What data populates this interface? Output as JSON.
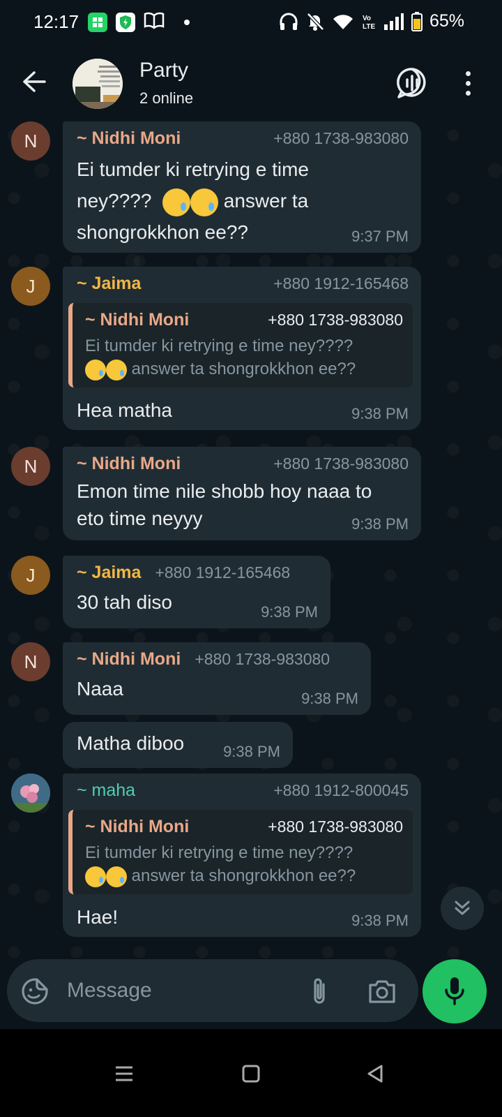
{
  "status_bar": {
    "time": "12:17",
    "battery_percent": "65%",
    "icons": [
      "app-icon",
      "shield-icon",
      "book-icon",
      "headphones-icon",
      "mute-icon",
      "wifi-icon",
      "volte-icon",
      "signal-icon",
      "battery-icon"
    ]
  },
  "header": {
    "title": "Party",
    "subtitle": "2 online"
  },
  "messages": [
    {
      "sender": "~ Nidhi Moni",
      "phone": "+880 1738-983080",
      "text_line1": "Ei tumder ki retrying e time",
      "text_line2_a": "ney????",
      "text_line2_b": "answer ta",
      "text_line3": "shongrokkhon ee??",
      "time": "9:37 PM",
      "avatar": "N"
    },
    {
      "sender": "~ Jaima",
      "phone": "+880 1912-165468",
      "quote_sender": "~ Nidhi Moni",
      "quote_phone": "+880 1738-983080",
      "quote_line1": "Ei tumder ki retrying e time ney????",
      "quote_line2": "answer ta shongrokkhon ee??",
      "text": "Hea matha",
      "time": "9:38 PM",
      "avatar": "J"
    },
    {
      "sender": "~ Nidhi Moni",
      "phone": "+880 1738-983080",
      "text_line1": "Emon time nile shobb hoy naaa to",
      "text_line2": "eto time neyyy",
      "time": "9:38 PM",
      "avatar": "N"
    },
    {
      "sender": "~ Jaima",
      "phone": "+880 1912-165468",
      "text": "30 tah diso",
      "time": "9:38 PM",
      "avatar": "J"
    },
    {
      "sender": "~ Nidhi Moni",
      "phone": "+880 1738-983080",
      "text": "Naaa",
      "time": "9:38 PM",
      "avatar": "N"
    },
    {
      "text": "Matha diboo",
      "time": "9:38 PM"
    },
    {
      "sender": "~ maha",
      "phone": "+880 1912-800045",
      "quote_sender": "~ Nidhi Moni",
      "quote_phone": "+880 1738-983080",
      "quote_line1": "Ei tumder ki retrying e time ney????",
      "quote_line2": "answer ta shongrokkhon ee??",
      "text": "Hae!",
      "time": "9:38 PM"
    }
  ],
  "input": {
    "placeholder": "Message"
  },
  "colors": {
    "accent_green": "#21c063",
    "bubble_bg": "#202c33",
    "nidhi_name": "#e8a888",
    "jaima_name": "#f1b645",
    "maha_name": "#4fcdb3"
  }
}
